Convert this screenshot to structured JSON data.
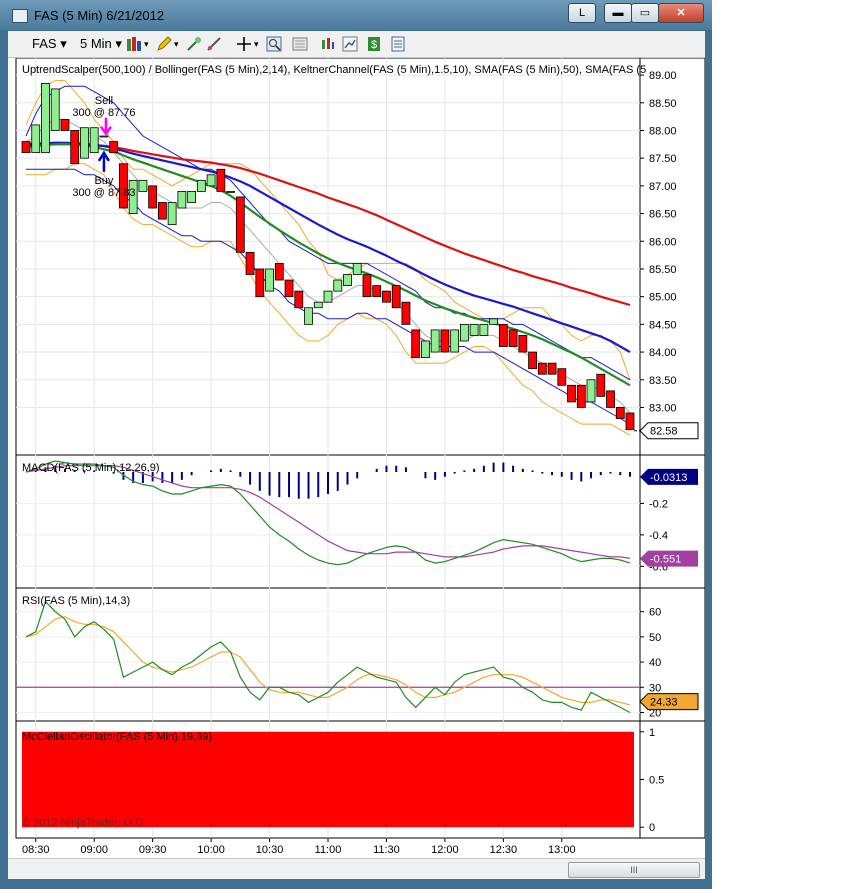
{
  "window": {
    "title": "FAS (5 Min)  6/21/2012",
    "btn_l": "L",
    "btn_min": "▬",
    "btn_max": "▭",
    "btn_close": "✕"
  },
  "toolbar": {
    "instrument": "FAS",
    "interval": "5 Min"
  },
  "footer": {
    "copyright": "© 2012 NinjaTrader, LLC",
    "scroll_thumb": "III"
  },
  "colors": {
    "bull": "#90ee90",
    "bear": "#ff0000",
    "bb": "#f0a830",
    "kc": "#1a1acc",
    "sma50": "#228b22",
    "sma_long": "#dd1111",
    "sma_short": "#aaaaaa",
    "macd_line": "#228b22",
    "macd_signal": "#a040a0",
    "histogram": "#000080"
  },
  "chart_data": [
    {
      "type": "candlestick",
      "title": "UptrendScalper(500,100) / Bollinger(FAS (5 Min),2,14), KeltnerChannel(FAS (5 Min),1.5,10), SMA(FAS (5 Min),50), SMA(FAS (5",
      "ylim": [
        82.25,
        89.2
      ],
      "yticks": [
        "89.00",
        "88.50",
        "88.00",
        "87.50",
        "87.00",
        "86.50",
        "86.00",
        "85.50",
        "85.00",
        "84.50",
        "84.00",
        "83.50",
        "83.00"
      ],
      "xticks": [
        "08:30",
        "09:00",
        "09:30",
        "10:00",
        "10:30",
        "11:00",
        "11:30",
        "12:00",
        "12:30",
        "13:00"
      ],
      "last_price": "82.58",
      "bars": [
        [
          87.8,
          87.6,
          87.8,
          87.6
        ],
        [
          87.6,
          88.1,
          87.6,
          88.1
        ],
        [
          87.6,
          88.85,
          88.85,
          87.6
        ],
        [
          88.0,
          88.75,
          88.75,
          88.0
        ],
        [
          88.2,
          88.0,
          88.2,
          88.0
        ],
        [
          88.0,
          87.4,
          88.0,
          87.4
        ],
        [
          87.5,
          88.05,
          88.05,
          87.5
        ],
        [
          87.6,
          88.05,
          88.05,
          87.6
        ],
        [
          87.9,
          87.9,
          87.9,
          87.9
        ],
        [
          87.8,
          87.6,
          87.8,
          87.6
        ],
        [
          87.4,
          86.6,
          87.4,
          86.6
        ],
        [
          86.5,
          87.1,
          87.1,
          86.5
        ],
        [
          86.9,
          87.1,
          87.1,
          86.9
        ],
        [
          87.0,
          86.6,
          87.0,
          86.6
        ],
        [
          86.7,
          86.4,
          86.7,
          86.4
        ],
        [
          86.3,
          86.7,
          86.7,
          86.3
        ],
        [
          86.6,
          86.9,
          86.9,
          86.6
        ],
        [
          86.7,
          86.9,
          86.9,
          86.7
        ],
        [
          86.9,
          87.1,
          87.1,
          86.9
        ],
        [
          87.0,
          87.2,
          87.2,
          87.0
        ],
        [
          87.3,
          86.9,
          87.3,
          86.9
        ],
        [
          86.9,
          86.9,
          86.9,
          86.9
        ],
        [
          86.8,
          85.8,
          86.8,
          85.8
        ],
        [
          85.8,
          85.4,
          85.8,
          85.4
        ],
        [
          85.5,
          85.0,
          85.5,
          85.0
        ],
        [
          85.1,
          85.5,
          85.5,
          85.1
        ],
        [
          85.6,
          85.3,
          85.6,
          85.3
        ],
        [
          85.3,
          85.0,
          85.3,
          85.0
        ],
        [
          85.1,
          84.8,
          85.1,
          84.8
        ],
        [
          84.5,
          84.8,
          84.8,
          84.5
        ],
        [
          84.8,
          84.9,
          84.9,
          84.8
        ],
        [
          84.9,
          85.1,
          85.1,
          84.9
        ],
        [
          85.1,
          85.3,
          85.3,
          85.1
        ],
        [
          85.2,
          85.4,
          85.4,
          85.2
        ],
        [
          85.4,
          85.6,
          85.6,
          85.4
        ],
        [
          85.4,
          85.0,
          85.4,
          85.0
        ],
        [
          85.2,
          85.0,
          85.2,
          85.0
        ],
        [
          85.1,
          84.9,
          85.1,
          84.9
        ],
        [
          85.2,
          84.8,
          85.2,
          84.8
        ],
        [
          84.9,
          84.5,
          84.9,
          84.5
        ],
        [
          84.4,
          83.9,
          84.4,
          83.9
        ],
        [
          83.9,
          84.2,
          84.2,
          83.9
        ],
        [
          84.0,
          84.4,
          84.4,
          84.0
        ],
        [
          84.4,
          84.0,
          84.4,
          84.0
        ],
        [
          84.0,
          84.4,
          84.4,
          84.0
        ],
        [
          84.2,
          84.5,
          84.5,
          84.2
        ],
        [
          84.3,
          84.5,
          84.5,
          84.3
        ],
        [
          84.3,
          84.5,
          84.5,
          84.3
        ],
        [
          84.5,
          84.6,
          84.6,
          84.5
        ],
        [
          84.5,
          84.1,
          84.5,
          84.1
        ],
        [
          84.4,
          84.1,
          84.4,
          84.1
        ],
        [
          84.3,
          84.0,
          84.3,
          84.0
        ],
        [
          84.0,
          83.7,
          84.0,
          83.7
        ],
        [
          83.8,
          83.6,
          83.8,
          83.6
        ],
        [
          83.8,
          83.6,
          83.8,
          83.6
        ],
        [
          83.7,
          83.4,
          83.7,
          83.4
        ],
        [
          83.4,
          83.1,
          83.4,
          83.1
        ],
        [
          83.4,
          83.0,
          83.4,
          83.0
        ],
        [
          83.1,
          83.5,
          83.5,
          83.1
        ],
        [
          83.6,
          83.2,
          83.6,
          83.2
        ],
        [
          83.3,
          83.0,
          83.3,
          83.0
        ],
        [
          83.0,
          82.8,
          83.0,
          82.8
        ],
        [
          82.9,
          82.6,
          82.9,
          82.6
        ]
      ],
      "bollinger_upper": [
        88.1,
        88.5,
        88.8,
        88.9,
        88.9,
        88.7,
        88.5,
        88.2,
        88.0,
        87.8,
        87.5,
        87.3,
        87.3,
        87.2,
        87.1,
        87.0,
        87.1,
        87.2,
        87.3,
        87.4,
        87.4,
        87.4,
        87.4,
        87.3,
        87.1,
        86.9,
        86.7,
        86.5,
        86.3,
        86.0,
        85.8,
        85.4,
        85.3,
        85.4,
        85.5,
        85.6,
        85.6,
        85.6,
        85.6,
        85.6,
        85.5,
        85.3,
        85.2,
        85.1,
        84.9,
        84.8,
        84.7,
        84.6,
        84.6,
        84.6,
        84.7,
        84.8,
        84.8,
        84.8,
        84.6,
        84.5,
        84.3,
        84.2,
        84.3,
        84.3,
        84.2,
        84.0,
        83.5
      ],
      "bollinger_lower": [
        87.2,
        87.2,
        87.2,
        87.3,
        87.3,
        87.4,
        87.4,
        87.3,
        87.2,
        86.9,
        86.6,
        86.4,
        86.3,
        86.3,
        86.2,
        86.1,
        86.0,
        85.9,
        85.9,
        86.0,
        86.0,
        86.0,
        85.7,
        85.4,
        85.1,
        84.9,
        84.7,
        84.5,
        84.3,
        84.2,
        84.2,
        84.3,
        84.5,
        84.6,
        84.7,
        84.6,
        84.6,
        84.5,
        84.3,
        84.0,
        83.8,
        83.8,
        83.8,
        83.8,
        83.9,
        84.0,
        84.1,
        84.1,
        84.0,
        83.8,
        83.6,
        83.4,
        83.3,
        83.1,
        83.0,
        82.9,
        82.8,
        82.7,
        82.7,
        82.7,
        82.7,
        82.6,
        82.5
      ],
      "keltner_upper": [
        87.9,
        88.3,
        88.6,
        88.7,
        88.8,
        88.8,
        88.8,
        88.7,
        88.6,
        88.5,
        88.3,
        88.1,
        87.9,
        87.8,
        87.7,
        87.6,
        87.5,
        87.4,
        87.3,
        87.3,
        87.2,
        87.1,
        86.9,
        86.7,
        86.5,
        86.3,
        86.2,
        86.0,
        85.9,
        85.8,
        85.7,
        85.6,
        85.6,
        85.6,
        85.6,
        85.6,
        85.5,
        85.4,
        85.3,
        85.2,
        85.1,
        84.9,
        84.8,
        84.8,
        84.7,
        84.7,
        84.6,
        84.6,
        84.6,
        84.6,
        84.5,
        84.5,
        84.4,
        84.3,
        84.2,
        84.1,
        84.0,
        83.9,
        83.9,
        83.8,
        83.7,
        83.6,
        83.5
      ],
      "keltner_lower": [
        87.3,
        87.3,
        87.3,
        87.3,
        87.3,
        87.3,
        87.2,
        87.2,
        87.1,
        87.0,
        86.8,
        86.7,
        86.5,
        86.4,
        86.3,
        86.2,
        86.1,
        86.1,
        86.0,
        86.0,
        86.0,
        85.9,
        85.8,
        85.6,
        85.4,
        85.2,
        85.1,
        84.9,
        84.8,
        84.7,
        84.7,
        84.6,
        84.6,
        84.6,
        84.7,
        84.7,
        84.6,
        84.6,
        84.5,
        84.4,
        84.3,
        84.2,
        84.1,
        84.1,
        84.1,
        84.1,
        84.0,
        84.0,
        84.0,
        83.9,
        83.8,
        83.7,
        83.6,
        83.5,
        83.4,
        83.3,
        83.2,
        83.1,
        83.1,
        83.0,
        82.9,
        82.8,
        82.7
      ],
      "sma50": [
        87.7,
        87.72,
        87.74,
        87.75,
        87.76,
        87.75,
        87.73,
        87.7,
        87.66,
        87.62,
        87.55,
        87.48,
        87.42,
        87.36,
        87.3,
        87.24,
        87.18,
        87.12,
        87.06,
        87.0,
        86.92,
        86.82,
        86.7,
        86.57,
        86.44,
        86.32,
        86.2,
        86.09,
        85.98,
        85.88,
        85.78,
        85.69,
        85.61,
        85.54,
        85.48,
        85.42,
        85.35,
        85.27,
        85.19,
        85.11,
        85.02,
        84.93,
        84.86,
        84.79,
        84.73,
        84.67,
        84.62,
        84.57,
        84.52,
        84.47,
        84.42,
        84.36,
        84.3,
        84.23,
        84.15,
        84.07,
        83.99,
        83.9,
        83.8,
        83.7,
        83.6,
        83.5,
        83.4
      ],
      "sma_blue": [
        87.75,
        87.76,
        87.77,
        87.78,
        87.78,
        87.77,
        87.76,
        87.74,
        87.72,
        87.68,
        87.63,
        87.58,
        87.54,
        87.5,
        87.46,
        87.42,
        87.38,
        87.34,
        87.3,
        87.26,
        87.21,
        87.15,
        87.08,
        87.0,
        86.9,
        86.8,
        86.7,
        86.6,
        86.5,
        86.4,
        86.3,
        86.21,
        86.12,
        86.04,
        85.97,
        85.9,
        85.82,
        85.74,
        85.65,
        85.57,
        85.48,
        85.39,
        85.3,
        85.22,
        85.15,
        85.08,
        85.02,
        84.97,
        84.92,
        84.87,
        84.82,
        84.76,
        84.7,
        84.64,
        84.58,
        84.52,
        84.46,
        84.4,
        84.34,
        84.28,
        84.2,
        84.1,
        84.0
      ],
      "sma_red": [
        87.72,
        87.73,
        87.74,
        87.75,
        87.75,
        87.75,
        87.74,
        87.73,
        87.72,
        87.7,
        87.67,
        87.63,
        87.6,
        87.57,
        87.54,
        87.51,
        87.48,
        87.46,
        87.44,
        87.42,
        87.39,
        87.36,
        87.32,
        87.27,
        87.22,
        87.16,
        87.1,
        87.04,
        86.98,
        86.92,
        86.86,
        86.79,
        86.73,
        86.67,
        86.61,
        86.54,
        86.47,
        86.39,
        86.31,
        86.23,
        86.15,
        86.07,
        85.99,
        85.92,
        85.85,
        85.78,
        85.72,
        85.66,
        85.6,
        85.54,
        85.48,
        85.43,
        85.37,
        85.32,
        85.27,
        85.22,
        85.16,
        85.11,
        85.06,
        85.0,
        84.95,
        84.9,
        84.85
      ],
      "sma_grey": [
        87.8,
        87.9,
        88.1,
        88.2,
        88.2,
        88.1,
        88.0,
        87.9,
        87.8,
        87.6,
        87.4,
        87.2,
        87.0,
        86.9,
        86.8,
        86.7,
        86.6,
        86.6,
        86.6,
        86.7,
        86.7,
        86.6,
        86.4,
        86.2,
        86.0,
        85.8,
        85.6,
        85.4,
        85.2,
        85.0,
        84.9,
        84.9,
        85.0,
        85.1,
        85.2,
        85.2,
        85.1,
        85.0,
        84.9,
        84.7,
        84.5,
        84.3,
        84.2,
        84.2,
        84.2,
        84.2,
        84.3,
        84.3,
        84.3,
        84.2,
        84.1,
        84.0,
        83.9,
        83.8,
        83.7,
        83.6,
        83.5,
        83.4,
        83.4,
        83.3,
        83.2,
        83.1,
        82.9
      ],
      "annotations": [
        {
          "text": "Sell",
          "sub": "300 @ 87.76",
          "signal": "sell",
          "bar": 8,
          "price": 87.76
        },
        {
          "text": "Buy",
          "sub": "300 @ 87.83",
          "signal": "buy",
          "bar": 8,
          "price": 87.83
        }
      ]
    },
    {
      "type": "line",
      "title": "MACD(FAS (5 Min),12,26,9)",
      "ylim": [
        -0.7,
        0.07
      ],
      "yticks": [
        "-0.2",
        "-0.4",
        "-0.6"
      ],
      "tick_values": [
        -0.2,
        -0.4,
        -0.6
      ],
      "last_macd": "-0.0313",
      "last_avg": "-0.551",
      "macd": [
        0.0,
        0.02,
        0.05,
        0.07,
        0.06,
        0.05,
        0.05,
        0.05,
        0.04,
        0.03,
        -0.02,
        -0.06,
        -0.08,
        -0.09,
        -0.12,
        -0.14,
        -0.14,
        -0.12,
        -0.1,
        -0.09,
        -0.08,
        -0.09,
        -0.14,
        -0.21,
        -0.28,
        -0.35,
        -0.4,
        -0.44,
        -0.49,
        -0.53,
        -0.56,
        -0.58,
        -0.59,
        -0.58,
        -0.55,
        -0.52,
        -0.5,
        -0.48,
        -0.47,
        -0.48,
        -0.51,
        -0.56,
        -0.58,
        -0.57,
        -0.55,
        -0.53,
        -0.51,
        -0.48,
        -0.45,
        -0.43,
        -0.44,
        -0.45,
        -0.46,
        -0.48,
        -0.5,
        -0.52,
        -0.55,
        -0.57,
        -0.56,
        -0.55,
        -0.55,
        -0.56,
        -0.58
      ],
      "avg": [
        0.0,
        0.01,
        0.02,
        0.03,
        0.04,
        0.04,
        0.04,
        0.04,
        0.04,
        0.04,
        0.03,
        0.01,
        -0.01,
        -0.03,
        -0.05,
        -0.07,
        -0.09,
        -0.1,
        -0.1,
        -0.1,
        -0.1,
        -0.1,
        -0.11,
        -0.13,
        -0.16,
        -0.2,
        -0.24,
        -0.28,
        -0.32,
        -0.36,
        -0.4,
        -0.44,
        -0.47,
        -0.5,
        -0.51,
        -0.52,
        -0.52,
        -0.52,
        -0.51,
        -0.51,
        -0.51,
        -0.52,
        -0.53,
        -0.54,
        -0.54,
        -0.54,
        -0.53,
        -0.52,
        -0.51,
        -0.49,
        -0.48,
        -0.47,
        -0.47,
        -0.47,
        -0.48,
        -0.49,
        -0.5,
        -0.51,
        -0.52,
        -0.53,
        -0.54,
        -0.54,
        -0.55
      ],
      "diff": [
        0.0,
        0.01,
        0.03,
        0.04,
        0.02,
        0.01,
        0.01,
        0.01,
        0.0,
        -0.01,
        -0.05,
        -0.07,
        -0.07,
        -0.06,
        -0.07,
        -0.07,
        -0.05,
        -0.02,
        0.0,
        0.01,
        0.02,
        0.01,
        -0.03,
        -0.08,
        -0.12,
        -0.15,
        -0.16,
        -0.16,
        -0.17,
        -0.17,
        -0.16,
        -0.14,
        -0.12,
        -0.08,
        -0.04,
        0.0,
        0.02,
        0.04,
        0.04,
        0.03,
        0.0,
        -0.04,
        -0.05,
        -0.03,
        -0.01,
        0.01,
        0.02,
        0.04,
        0.06,
        0.06,
        0.04,
        0.02,
        0.01,
        -0.01,
        -0.02,
        -0.03,
        -0.05,
        -0.06,
        -0.04,
        -0.02,
        -0.01,
        -0.02,
        -0.03
      ]
    },
    {
      "type": "line",
      "title": "RSI(FAS (5 Min),14,3)",
      "ylim": [
        19,
        67
      ],
      "yticks": [
        "60",
        "50",
        "40",
        "30",
        "20"
      ],
      "tick_values": [
        60,
        50,
        40,
        30,
        20
      ],
      "reference_line": 30,
      "last_rsi": "24.33",
      "rsi": [
        50,
        52,
        64,
        60,
        57,
        50,
        54,
        56,
        53,
        49,
        34,
        36,
        38,
        40,
        37,
        35,
        38,
        40,
        43,
        46,
        48,
        44,
        34,
        28,
        25,
        30,
        30,
        28,
        27,
        24,
        26,
        28,
        32,
        35,
        38,
        36,
        34,
        33,
        32,
        26,
        22,
        26,
        30,
        27,
        32,
        35,
        36,
        37,
        38,
        34,
        33,
        30,
        28,
        25,
        24,
        24,
        22,
        21,
        28,
        26,
        24,
        22,
        20
      ],
      "avg": [
        50,
        51,
        54,
        57,
        58,
        56,
        55,
        55,
        54,
        52,
        48,
        44,
        40,
        38,
        37,
        36,
        37,
        38,
        40,
        42,
        44,
        44,
        42,
        37,
        32,
        29,
        28,
        28,
        28,
        27,
        26,
        26,
        28,
        30,
        33,
        35,
        35,
        34,
        33,
        31,
        28,
        26,
        26,
        27,
        28,
        30,
        32,
        34,
        35,
        35,
        35,
        34,
        32,
        30,
        28,
        26,
        25,
        24,
        24,
        25,
        25,
        24,
        23
      ]
    },
    {
      "type": "area",
      "title": "McClellanOscillator(FAS (5 Min),19,39)",
      "ylim": [
        0,
        1
      ],
      "yticks": [
        "1",
        "0.5",
        "0"
      ],
      "tick_values": [
        1,
        0.5,
        0
      ],
      "fill_value": 1
    }
  ]
}
